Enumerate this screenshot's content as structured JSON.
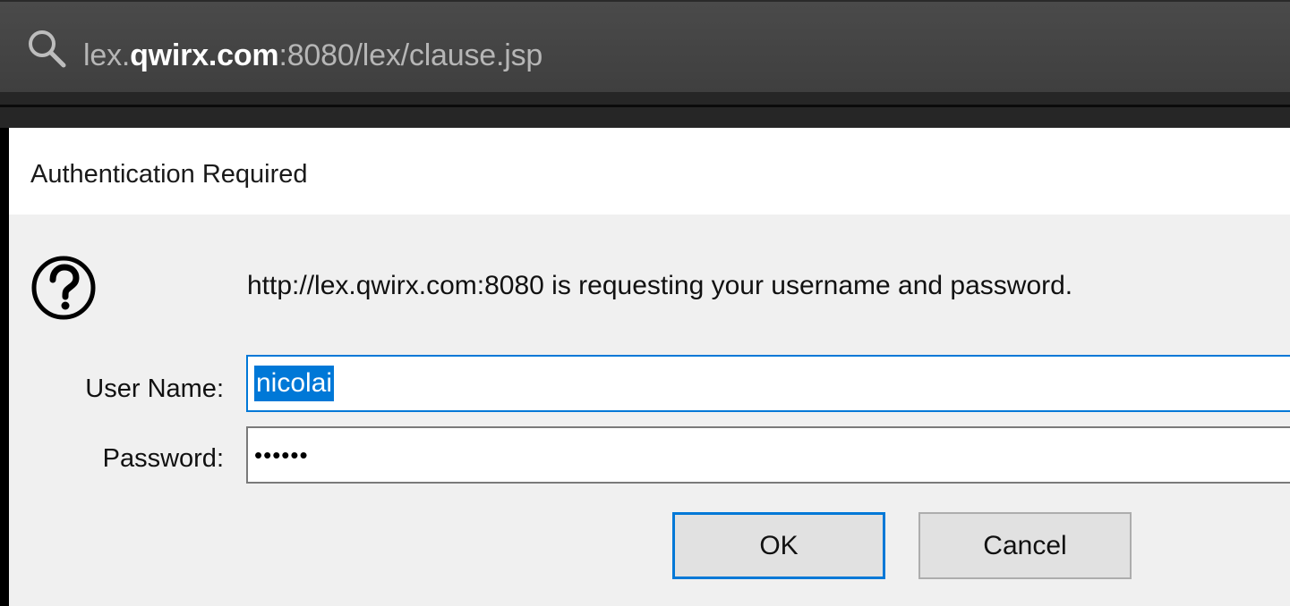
{
  "browser": {
    "url": {
      "subdomain": "lex.",
      "host": "qwirx.com",
      "rest": ":8080/lex/clause.jsp"
    },
    "search_icon": "search-icon"
  },
  "dialog": {
    "title": "Authentication Required",
    "icon": "question-icon",
    "message": "http://lex.qwirx.com:8080 is requesting your username and password.",
    "username_label": "User Name:",
    "username_value": "nicolai",
    "password_label": "Password:",
    "password_value": "••••••",
    "ok_label": "OK",
    "cancel_label": "Cancel"
  },
  "colors": {
    "accent": "#0078d7",
    "addressbar_bg": "#444444",
    "dialog_bg": "#f0f0f0"
  }
}
